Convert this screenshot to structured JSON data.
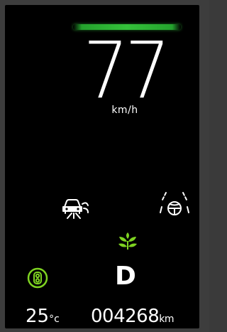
{
  "speedometer": {
    "value": "77",
    "unit": "km/h"
  },
  "eco_indicator": {
    "color": "#34c23a"
  },
  "indicators": {
    "left_assist_icon": "car-distance-warning-icon",
    "right_assist_icon": "lane-keeping-assist-icon",
    "eco_icon": "eco-leaf-icon",
    "cruise_icon": "cruise-ready-icon",
    "eco_color": "#7ed321"
  },
  "gear": {
    "position": "D"
  },
  "temperature": {
    "value": "25",
    "unit": "°c"
  },
  "odometer": {
    "value": "004268",
    "unit": "km"
  }
}
